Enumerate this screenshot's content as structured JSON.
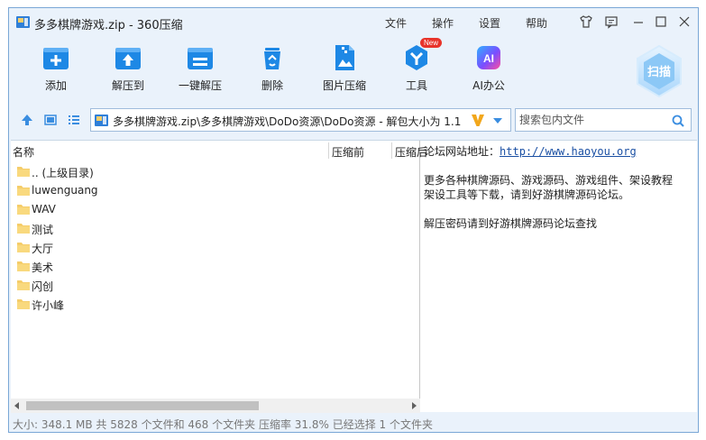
{
  "window": {
    "title": "多多棋牌游戏.zip - 360压缩"
  },
  "menu": [
    {
      "label": "文件"
    },
    {
      "label": "操作"
    },
    {
      "label": "设置"
    },
    {
      "label": "帮助"
    }
  ],
  "toolbar": {
    "add": "添加",
    "extract_to": "解压到",
    "one_click_extract": "一键解压",
    "delete": "删除",
    "image_compress": "图片压缩",
    "tools": "工具",
    "tools_badge": "New",
    "ai_office": "AI办公",
    "ai_icon_text": "AI",
    "scan": "扫描"
  },
  "navbar": {
    "path": "多多棋牌游戏.zip\\多多棋牌游戏\\DoDo资源\\DoDo资源 - 解包大小为 1.1",
    "search_placeholder": "搜索包内文件"
  },
  "file_list": {
    "columns": [
      "名称",
      "压缩前",
      "压缩后"
    ],
    "items": [
      {
        "name": ".. (上级目录)"
      },
      {
        "name": "luwenguang"
      },
      {
        "name": "WAV"
      },
      {
        "name": "测试"
      },
      {
        "name": "大厅"
      },
      {
        "name": "美术"
      },
      {
        "name": "闪创"
      },
      {
        "name": "许小峰"
      }
    ]
  },
  "comment": {
    "site_label": "论坛网站地址：",
    "site_url": "http://www.haoyou.org",
    "line2": "更多各种棋牌源码、游戏源码、游戏组件、架设教程",
    "line3": "架设工具等下载，请到好游棋牌源码论坛。",
    "line4": "解压密码请到好游棋牌源码论坛查找"
  },
  "status": {
    "text": "大小: 348.1 MB 共 5828 个文件和 468 个文件夹 压缩率 31.8% 已经选择 1 个文件夹"
  },
  "colors": {
    "accent": "#1e88e5",
    "folder": "#f5cd6a",
    "window_bg": "#eaf2fb"
  }
}
